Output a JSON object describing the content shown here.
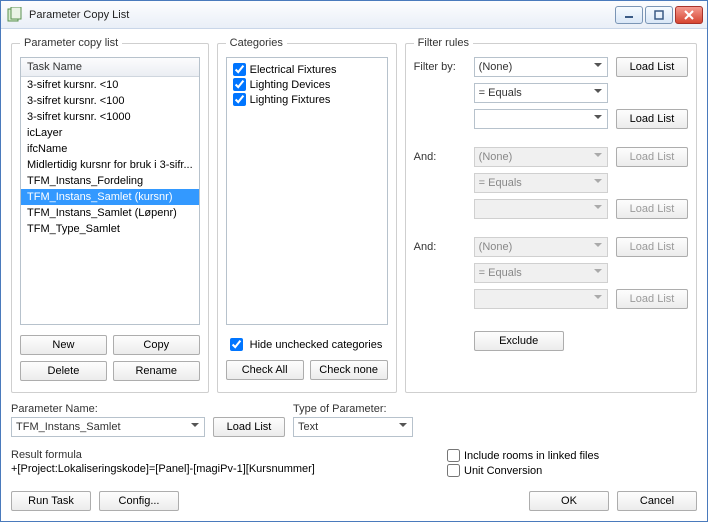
{
  "window": {
    "title": "Parameter Copy List"
  },
  "groups": {
    "paramList": "Parameter copy list",
    "categories": "Categories",
    "filter": "Filter rules"
  },
  "paramList": {
    "header": "Task Name",
    "items": [
      "3-sifret kursnr. <10",
      "3-sifret kursnr. <100",
      "3-sifret kursnr. <1000",
      "icLayer",
      "ifcName",
      "Midlertidig kursnr for bruk i 3-sifr...",
      "TFM_Instans_Fordeling",
      "TFM_Instans_Samlet (kursnr)",
      "TFM_Instans_Samlet (Løpenr)",
      "TFM_Type_Samlet"
    ],
    "selectedIndex": 7,
    "buttons": {
      "new": "New",
      "copy": "Copy",
      "delete": "Delete",
      "rename": "Rename"
    }
  },
  "categories": {
    "items": [
      {
        "label": "Electrical Fixtures",
        "checked": true
      },
      {
        "label": "Lighting Devices",
        "checked": true
      },
      {
        "label": "Lighting Fixtures",
        "checked": true
      }
    ],
    "hideUnchecked": {
      "label": "Hide unchecked categories",
      "checked": true
    },
    "checkAll": "Check All",
    "checkNone": "Check none"
  },
  "filter": {
    "filterByLabel": "Filter by:",
    "andLabel": "And:",
    "loadList": "Load List",
    "excludeLabel": "Exclude",
    "rules": [
      {
        "field": "(None)",
        "op": "= Equals",
        "value": "",
        "enabled": true
      },
      {
        "field": "(None)",
        "op": "= Equals",
        "value": "",
        "enabled": false
      },
      {
        "field": "(None)",
        "op": "= Equals",
        "value": "",
        "enabled": false
      }
    ]
  },
  "paramName": {
    "label": "Parameter Name:",
    "value": "TFM_Instans_Samlet",
    "loadList": "Load List"
  },
  "typeOfParam": {
    "label": "Type of Parameter:",
    "value": "Text"
  },
  "result": {
    "label": "Result formula",
    "value": "+[Project:Lokaliseringskode]=[Panel]-[magiPv-1][Kursnummer]"
  },
  "options": {
    "includeRooms": {
      "label": "Include rooms in linked files",
      "checked": false
    },
    "unitConversion": {
      "label": "Unit Conversion",
      "checked": false
    }
  },
  "bottom": {
    "runTask": "Run Task",
    "config": "Config...",
    "ok": "OK",
    "cancel": "Cancel"
  }
}
